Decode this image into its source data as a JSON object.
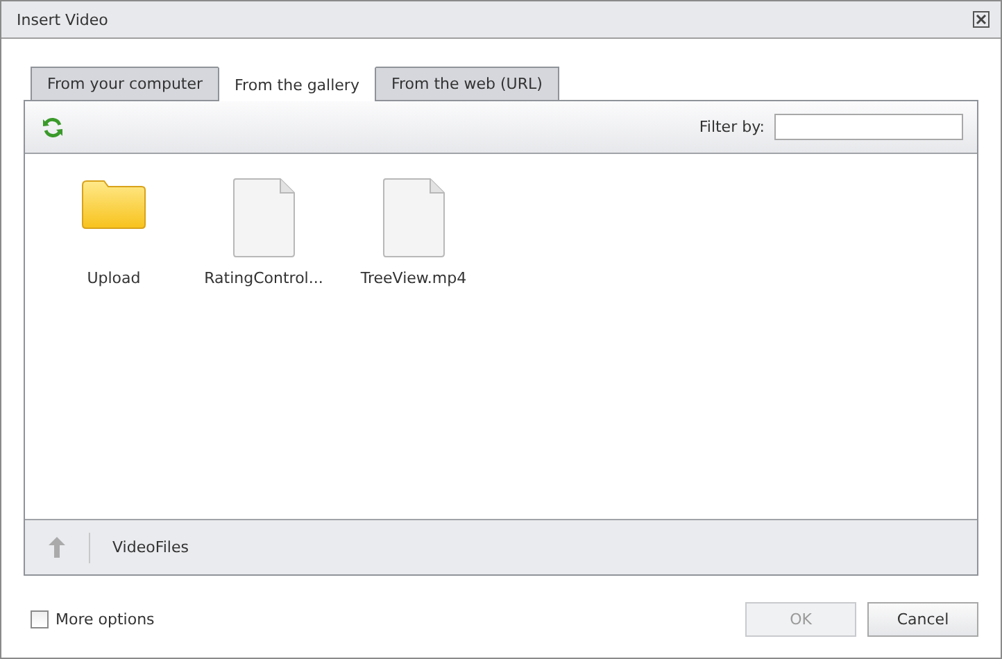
{
  "window": {
    "title": "Insert Video"
  },
  "tabs": [
    {
      "label": "From your computer",
      "selected": false
    },
    {
      "label": "From the gallery",
      "selected": true
    },
    {
      "label": "From the web (URL)",
      "selected": false
    }
  ],
  "filter": {
    "label": "Filter by:"
  },
  "files": [
    {
      "kind": "folder",
      "name": "Upload"
    },
    {
      "kind": "file",
      "name": "RatingControl..."
    },
    {
      "kind": "file",
      "name": "TreeView.mp4"
    }
  ],
  "path": "VideoFiles",
  "more_options": {
    "label": "More options",
    "checked": false
  },
  "buttons": [
    {
      "label": "OK",
      "disabled": true
    },
    {
      "label": "Cancel",
      "disabled": false
    }
  ]
}
